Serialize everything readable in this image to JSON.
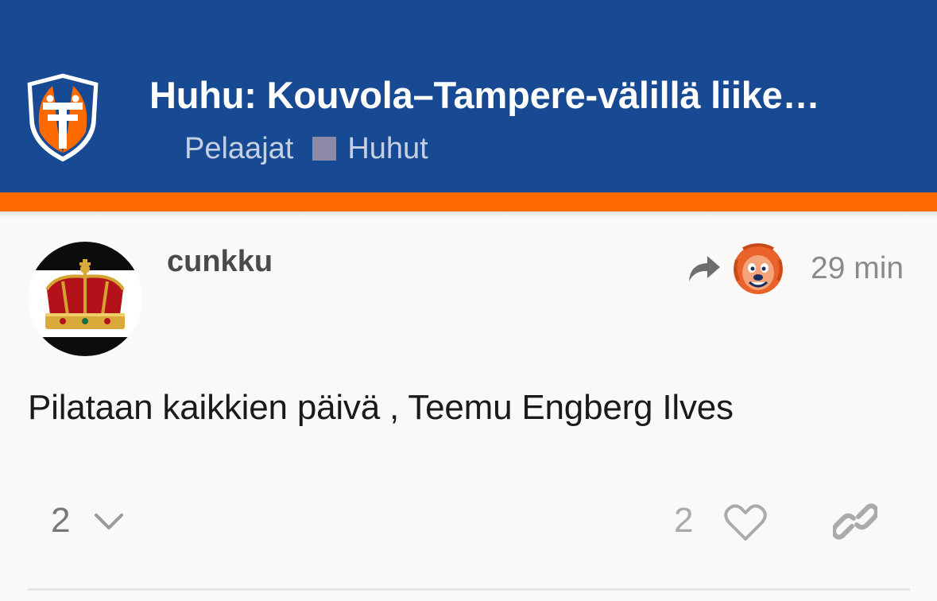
{
  "header": {
    "logo": "club-shield-logo",
    "title": "Huhu: Kouvola–Tampere-välillä liike…",
    "breadcrumbs": {
      "category": "Pelaajat",
      "subcategory": "Huhut",
      "subcategory_color": "#8c8aa6"
    },
    "background_color": "#184a93",
    "accent_color": "#ff6a00"
  },
  "post": {
    "author": "cunkku",
    "avatar": "crown-avatar",
    "reply_to_icon": "share-arrow-icon",
    "reply_to_avatar": "lion-mascot-avatar",
    "time": "29 min",
    "body": "Pilataan kaikkien päivä , Teemu Engberg Ilves",
    "replies": "2",
    "likes": "2"
  }
}
